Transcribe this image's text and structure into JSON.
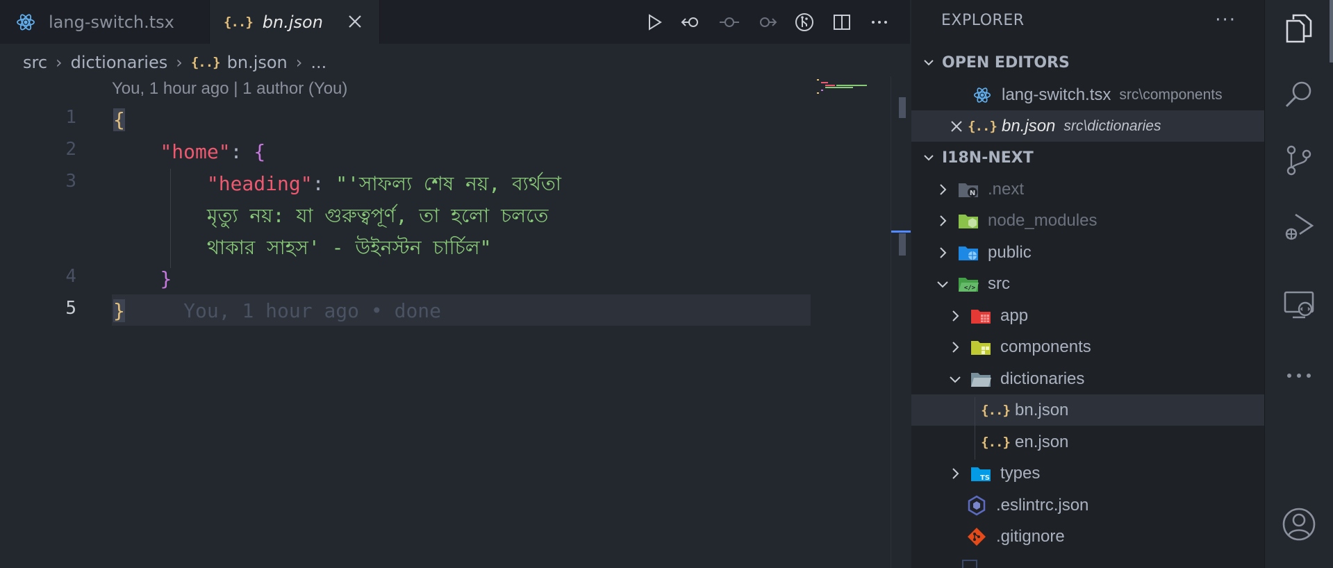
{
  "tabs": [
    {
      "label": "lang-switch.tsx",
      "icon": "react-icon"
    },
    {
      "label": "bn.json",
      "icon": "json-icon"
    }
  ],
  "breadcrumb": {
    "items": [
      "src",
      "dictionaries",
      "bn.json",
      "..."
    ]
  },
  "editor": {
    "codelens": "You, 1 hour ago | 1 author (You)",
    "line_numbers": [
      "1",
      "2",
      "3",
      "4",
      "5"
    ],
    "line1_brace": "{",
    "line2_key": "\"home\"",
    "line2_colon": ": ",
    "line2_brace": "{",
    "line3_key": "\"heading\"",
    "line3_colon": ": ",
    "line3_part1": "\"'সাফল্য শেষ নয়, ব্যর্থতা",
    "line3_part2": "মৃত্যু নয়: যা গুরুত্বপূর্ণ, তা হলো চলতে",
    "line3_part3": "থাকার সাহস' - উইনস্টন চার্চিল\"",
    "line4_brace": "}",
    "line5_brace": "}",
    "blame": "You, 1 hour ago • done"
  },
  "explorer": {
    "title": "EXPLORER",
    "more": "···",
    "open_editors_header": "OPEN EDITORS",
    "open_editors": [
      {
        "label": "lang-switch.tsx",
        "desc": "src\\components"
      },
      {
        "label": "bn.json",
        "desc": "src\\dictionaries"
      }
    ],
    "project_header": "I18N-NEXT",
    "tree": [
      {
        "label": ".next"
      },
      {
        "label": "node_modules"
      },
      {
        "label": "public"
      },
      {
        "label": "src"
      },
      {
        "label": "app"
      },
      {
        "label": "components"
      },
      {
        "label": "dictionaries"
      },
      {
        "label": "bn.json"
      },
      {
        "label": "en.json"
      },
      {
        "label": "types"
      },
      {
        "label": ".eslintrc.json"
      },
      {
        "label": ".gitignore"
      }
    ]
  },
  "colors": {
    "editor_bg": "#23272e",
    "sidebar_bg": "#1e2227",
    "key": "#ef596f",
    "string": "#89ca78",
    "brace": "#e5c07b",
    "accent": "#528bff"
  }
}
